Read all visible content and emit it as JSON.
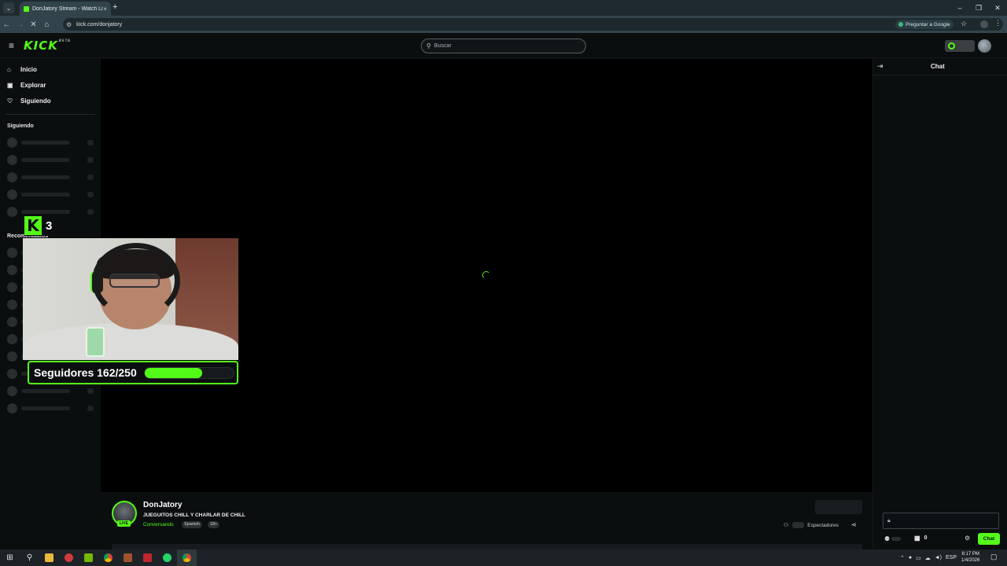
{
  "browser": {
    "tab_title": "DonJatory Stream - Watch Live",
    "tab_close": "×",
    "new_tab": "+",
    "url": "kick.com/donjatory",
    "ask_google": "Preguntar a Google",
    "window_controls": [
      "–",
      "❐",
      "✕"
    ]
  },
  "header": {
    "logo_text": "KICK",
    "logo_beta": "BETA",
    "search_placeholder": "Buscar"
  },
  "sidebar": {
    "nav": [
      {
        "label": "Inicio",
        "icon": "home-icon"
      },
      {
        "label": "Explorar",
        "icon": "explore-icon"
      },
      {
        "label": "Siguiendo",
        "icon": "heart-icon"
      }
    ],
    "following_heading": "Siguiendo",
    "recommended_heading": "Recomendados"
  },
  "overlay": {
    "k_badge_letter": "K",
    "k_badge_count": "3",
    "followers_text": "Seguidores 162/250",
    "followers_progress": 0.648
  },
  "stream": {
    "streamer": "DonJatory",
    "title": "JUEGUITOS CHILL Y CHARLAR DE CHILL",
    "category": "Conversando",
    "tags": [
      "Spanish",
      "18+"
    ],
    "live_label": "LIVE",
    "viewers_label": "Espectadores"
  },
  "chat": {
    "title": "Chat",
    "chest_count": "0",
    "send_label": "Chat"
  },
  "taskbar": {
    "time": "8:17 PM",
    "date": "1/4/2026",
    "lang": "ESP"
  },
  "colors": {
    "accent": "#53fc18",
    "background": "#0b0e0f"
  }
}
